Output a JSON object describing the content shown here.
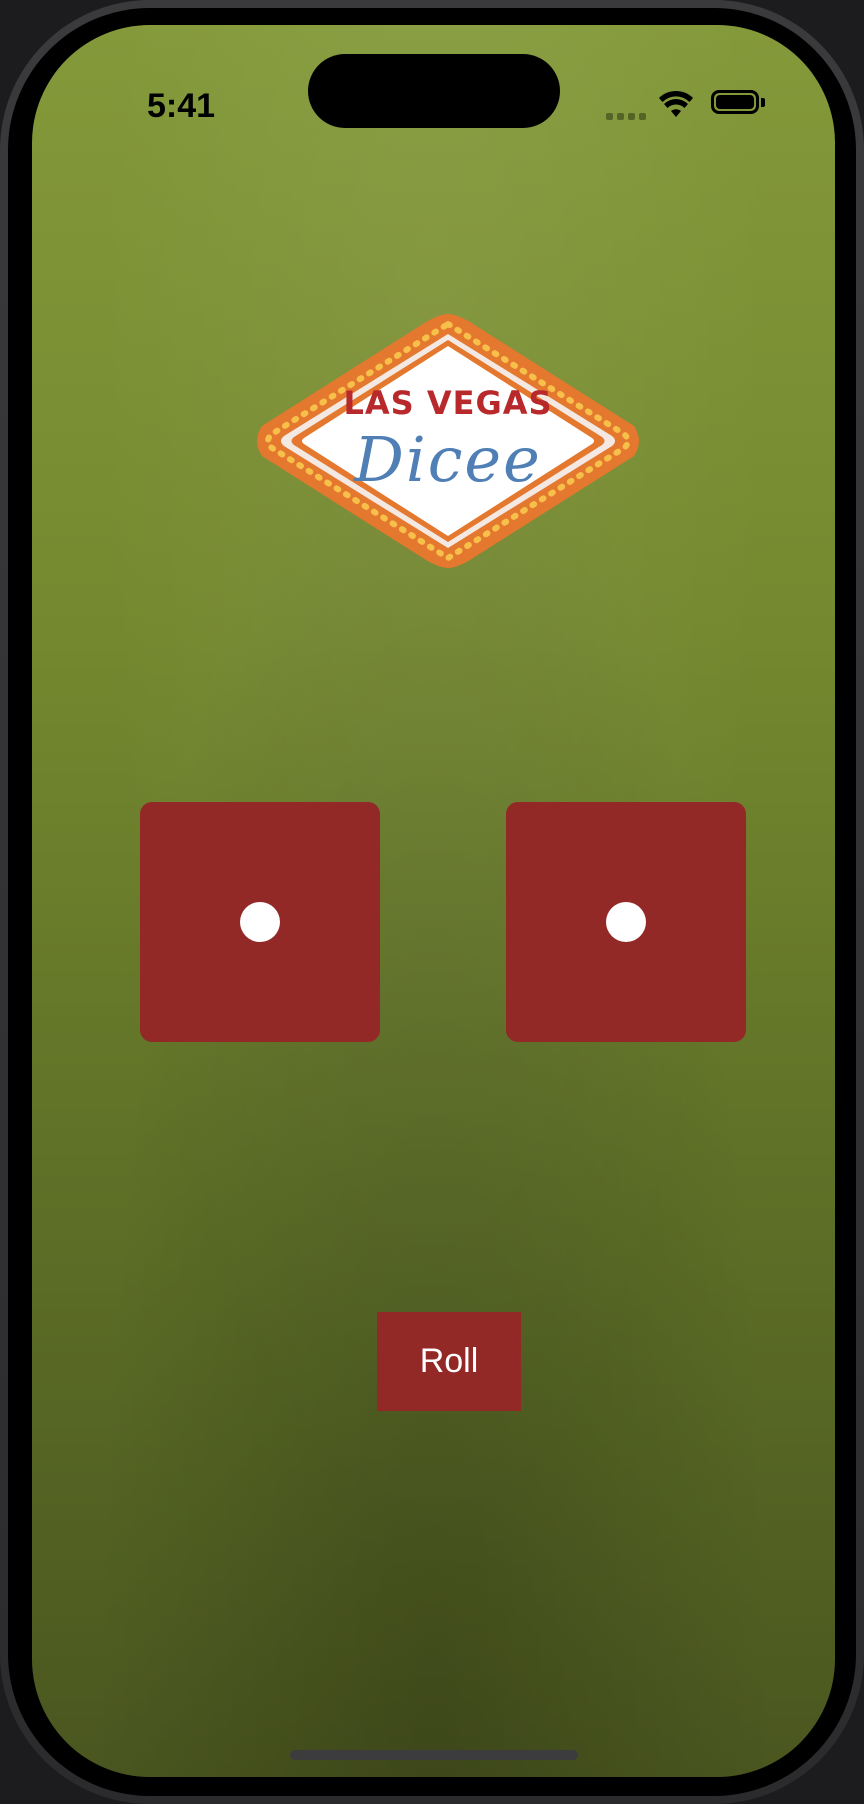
{
  "status_bar": {
    "time": "5:41",
    "icons": [
      "cellular-signal-icon",
      "wifi-icon",
      "battery-icon"
    ]
  },
  "logo": {
    "line1": "LAS VEGAS",
    "line2": "Dicee"
  },
  "dice": [
    {
      "face": 1
    },
    {
      "face": 1
    }
  ],
  "roll_button": {
    "label": "Roll"
  },
  "colors": {
    "felt_top": "#84993a",
    "felt_bottom": "#4a561f",
    "dice_red": "#922926",
    "pip": "#ffffff",
    "logo_red": "#b8292b",
    "logo_blue": "#4f7fb5",
    "logo_orange": "#e4782e"
  }
}
